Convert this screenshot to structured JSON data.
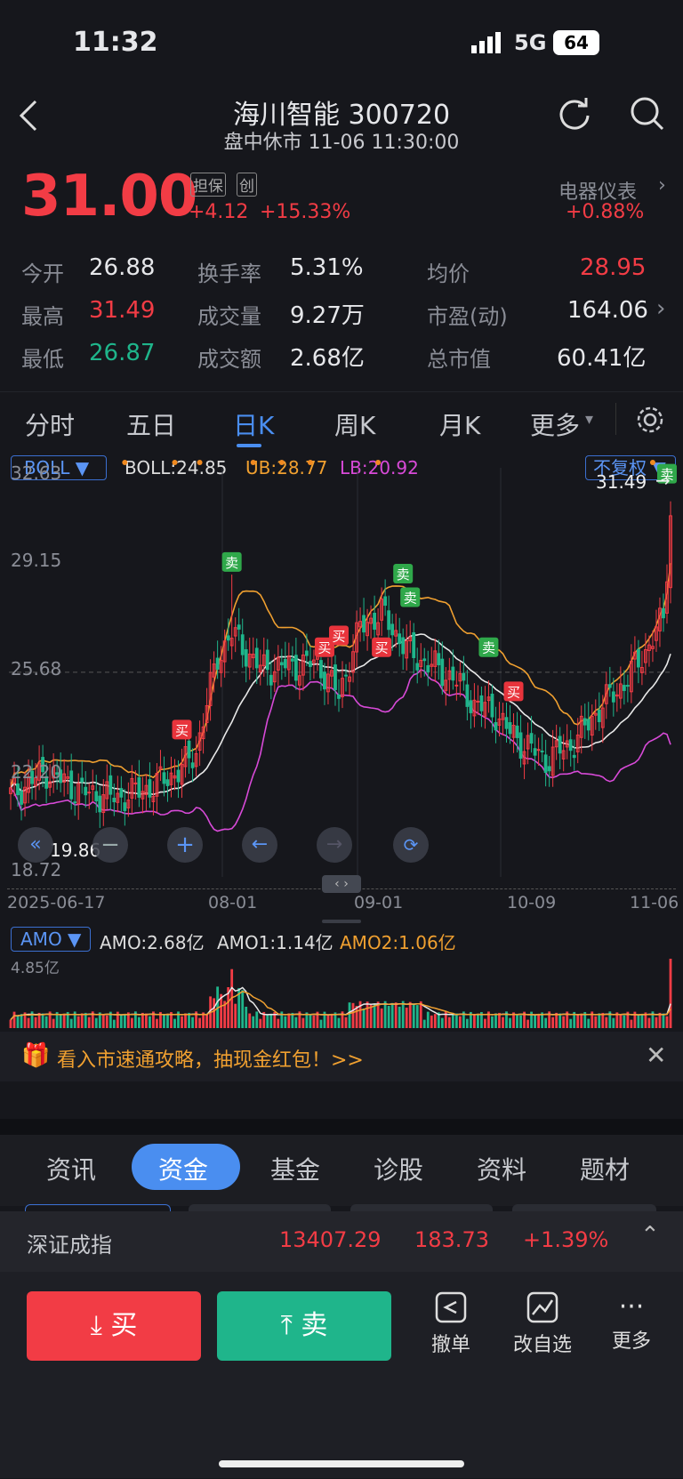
{
  "status": {
    "time": "11:32",
    "network": "5G",
    "battery": "64"
  },
  "header": {
    "title": "海川智能 300720",
    "subtitle": "盘中休市 11-06 11:30:00"
  },
  "quote": {
    "price": "31.00",
    "badge1": "担保",
    "badge2": "创",
    "change": "+4.12",
    "change_pct": "+15.33%",
    "sector": "电器仪表",
    "sector_pct": "+0.88%",
    "stats": [
      {
        "label": "今开",
        "value": "26.88"
      },
      {
        "label": "换手率",
        "value": "5.31%"
      },
      {
        "label": "均价",
        "value": "28.95"
      },
      {
        "label": "最高",
        "value": "31.49"
      },
      {
        "label": "成交量",
        "value": "9.27万"
      },
      {
        "label": "市盈(动)",
        "value": "164.06"
      },
      {
        "label": "最低",
        "value": "26.87"
      },
      {
        "label": "成交额",
        "value": "2.68亿"
      },
      {
        "label": "总市值",
        "value": "60.41亿"
      }
    ]
  },
  "chart_tabs": [
    "分时",
    "五日",
    "日K",
    "周K",
    "月K",
    "更多"
  ],
  "indicator": {
    "name": "BOLL",
    "boll": "BOLL:24.85",
    "ub": "UB:28.77",
    "lb": "LB:20.92",
    "adjust": "不复权"
  },
  "price_axis": [
    "32.63",
    "29.15",
    "25.68",
    "22.20",
    "18.72"
  ],
  "max_label": "31.49",
  "min_label": "19.86",
  "date_axis": [
    "2025-06-17",
    "08-01",
    "09-01",
    "10-09",
    "11-06"
  ],
  "amo": {
    "name": "AMO",
    "amo": "AMO:2.68亿",
    "amo1": "AMO1:1.14亿",
    "amo2": "AMO2:1.06亿",
    "max": "4.85亿"
  },
  "signals": {
    "buy": "买",
    "sell": "卖"
  },
  "promo": "看入市速通攻略，抽现金红包！>>",
  "info_tabs": [
    "资讯",
    "资金",
    "基金",
    "诊股",
    "资料",
    "题材"
  ],
  "index": {
    "name": "深证成指",
    "value": "13407.29",
    "change": "183.73",
    "pct": "+1.39%"
  },
  "actions": {
    "buy": "买",
    "sell": "卖",
    "cancel": "撤单",
    "edit_watch": "改自选",
    "more": "更多"
  },
  "colors": {
    "up": "#f23c45",
    "down": "#1fb58b",
    "accent": "#4a8ef0",
    "ub_line": "#f0a030",
    "lb_line": "#d84ad8",
    "mid_line": "#e8e8e8"
  },
  "chart_data": {
    "type": "candlestick",
    "x": [
      "2025-06-17",
      "08-01",
      "09-01",
      "10-09",
      "11-06"
    ],
    "ylim": [
      18.72,
      32.63
    ],
    "series": [
      {
        "name": "BOLL",
        "values": [
          24.85
        ]
      },
      {
        "name": "UB",
        "values": [
          28.77
        ]
      },
      {
        "name": "LB",
        "values": [
          20.92
        ]
      }
    ],
    "last_close": 31.0,
    "high": 31.49,
    "low_marker": 19.86
  }
}
